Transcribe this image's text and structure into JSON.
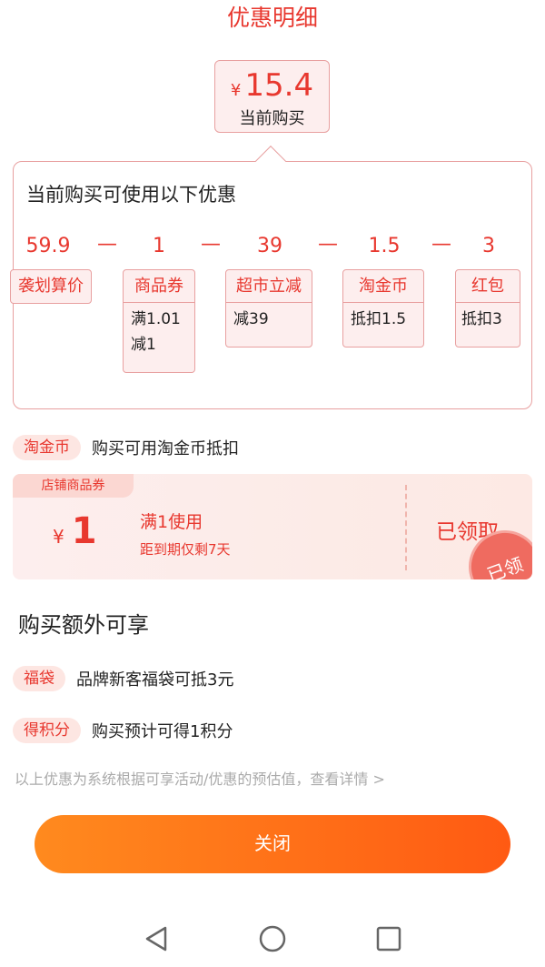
{
  "header": {
    "title": "优惠明细"
  },
  "current_price": {
    "currency": "¥",
    "amount": "15.4",
    "label": "当前购买"
  },
  "detail": {
    "heading": "当前购买可使用以下优惠",
    "calc": [
      "59.9",
      "1",
      "39",
      "1.5",
      "3"
    ],
    "minus": "—",
    "tags": [
      {
        "head": "袭划算价",
        "body": []
      },
      {
        "head": "商品券",
        "body": [
          "满1.01",
          "减1"
        ]
      },
      {
        "head": "超市立减",
        "body": [
          "减39"
        ]
      },
      {
        "head": "淘金币",
        "body": [
          "抵扣1.5"
        ]
      },
      {
        "head": "红包",
        "body": [
          "抵扣3"
        ]
      }
    ]
  },
  "taojinbi": {
    "pill": "淘金币",
    "text": "购买可用淘金币抵扣"
  },
  "coupon": {
    "ribbon": "店铺商品券",
    "currency": "¥",
    "amount": "1",
    "condition": "满1使用",
    "expire": "距到期仅剩7天",
    "status": "已领取",
    "stamp": "已领"
  },
  "extra": {
    "title": "购买额外可享",
    "items": [
      {
        "pill": "福袋",
        "text": "品牌新客福袋可抵3元"
      },
      {
        "pill": "得积分",
        "text": "购买预计可得1积分"
      }
    ]
  },
  "disclaimer": "以上优惠为系统根据可享活动/优惠的预估值，查看详情 >",
  "close_button": "关闭",
  "nav": {
    "back": "back-icon",
    "home": "home-icon",
    "recent": "recent-apps-icon"
  },
  "colors": {
    "accent": "#e8382f",
    "button_start": "#ff8a1e",
    "button_end": "#ff5a13",
    "tag_bg": "#fdeeee"
  }
}
